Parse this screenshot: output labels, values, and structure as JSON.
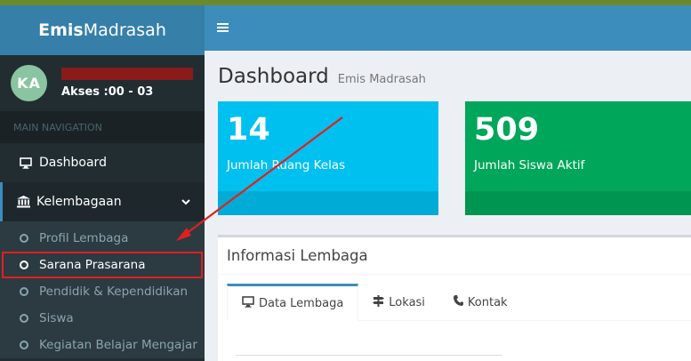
{
  "sidebar": {
    "brand_bold": "Emis",
    "brand_rest": "Madrasah",
    "user": {
      "initials": "KA",
      "access": "Akses :00 - 03"
    },
    "nav_header": "MAIN NAVIGATION",
    "items": [
      {
        "label": "Dashboard",
        "icon": "monitor-icon"
      },
      {
        "label": "Kelembagaan",
        "icon": "bank-icon"
      }
    ],
    "submenu": [
      {
        "label": "Profil Lembaga"
      },
      {
        "label": "Sarana Prasarana"
      },
      {
        "label": "Pendidik & Kependidikan"
      },
      {
        "label": "Siswa"
      },
      {
        "label": "Kegiatan Belajar Mengajar"
      }
    ]
  },
  "topbar": {
    "menu_icon": "hamburger-icon"
  },
  "main": {
    "title": "Dashboard",
    "subtitle": "Emis Madrasah",
    "stats": [
      {
        "value": "14",
        "label": "Jumlah Ruang Kelas",
        "color": "#00c0ef"
      },
      {
        "value": "509",
        "label": "Jumlah Siswa Aktif",
        "color": "#00a65a"
      }
    ],
    "panel": {
      "title": "Informasi Lembaga",
      "tabs": [
        {
          "label": "Data Lembaga",
          "icon": "monitor-icon"
        },
        {
          "label": "Lokasi",
          "icon": "signpost-icon"
        },
        {
          "label": "Kontak",
          "icon": "phone-icon"
        }
      ]
    }
  },
  "colors": {
    "sidebar_bg": "#222d32",
    "brand_bg": "#367fa9",
    "topbar_bg": "#3c8dbc",
    "highlight": "#e02020"
  }
}
